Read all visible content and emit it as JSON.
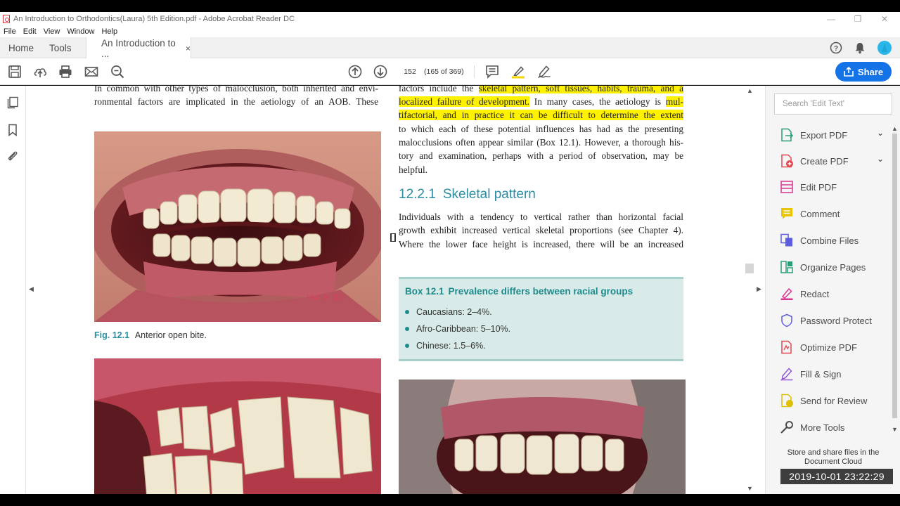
{
  "window": {
    "title": "An Introduction to Orthodontics(Laura) 5th Edition.pdf - Adobe Acrobat Reader DC"
  },
  "menu": [
    "File",
    "Edit",
    "View",
    "Window",
    "Help"
  ],
  "tabs": {
    "home": "Home",
    "tools": "Tools",
    "doc": "An Introduction to ...",
    "close": "×"
  },
  "toolbar": {
    "page_number": "152",
    "page_of": "(165 of 369)",
    "share_label": "Share"
  },
  "page": {
    "left_para_lines": [
      "In common with other types of malocclusion, both inherited and envi-",
      "ronmental factors are implicated in the aetiology of an AOB. These"
    ],
    "right_para1": {
      "l1_pre": "factors include the ",
      "l1_hl": "skeletal pattern, soft tissues, habits, trauma, and a",
      "l2_hl": "localized failure of development.",
      "l2_post": " In many cases, the aetiology is ",
      "l2_hl2": "mul-",
      "l3_hl": "tifactorial, and in practice it can be difficult to determine the extent",
      "l4": "to which each of these potential influences has had as the presenting",
      "l5": "malocclusions often appear similar (Box 12.1). However, a thorough his-",
      "l6": "tory and examination, perhaps with a period of observation, may be",
      "l7": "helpful."
    },
    "section": {
      "number": "12.2.1",
      "title": "Skeletal pattern"
    },
    "right_para2_lines": [
      "Individuals with a tendency to vertical rather than horizontal facial",
      "growth exhibit increased vertical skeletal proportions (see Chapter 4).",
      "Where the lower face height is increased, there will be an increased"
    ],
    "figure": {
      "label": "Fig. 12.1",
      "caption": "Anterior open bite."
    },
    "box": {
      "number": "Box 12.1",
      "title": "Prevalence differs between racial groups",
      "items": [
        "Caucasians: 2–4%.",
        "Afro-Caribbean: 5–10%.",
        "Chinese: 1.5–6%."
      ]
    }
  },
  "right_pane": {
    "search_placeholder": "Search 'Edit Text'",
    "tools": [
      {
        "label": "Export PDF",
        "icon": "export-pdf-icon",
        "color": "#2d9d78"
      },
      {
        "label": "Create PDF",
        "icon": "create-pdf-icon",
        "color": "#e34850"
      },
      {
        "label": "Edit PDF",
        "icon": "edit-pdf-icon",
        "color": "#d83790"
      },
      {
        "label": "Comment",
        "icon": "comment-icon",
        "color": "#dfbf00"
      },
      {
        "label": "Combine Files",
        "icon": "combine-files-icon",
        "color": "#5c5ce0"
      },
      {
        "label": "Organize Pages",
        "icon": "organize-pages-icon",
        "color": "#2d9d78"
      },
      {
        "label": "Redact",
        "icon": "redact-icon",
        "color": "#d83790"
      },
      {
        "label": "Password Protect",
        "icon": "password-protect-icon",
        "color": "#5c5ce0"
      },
      {
        "label": "Optimize PDF",
        "icon": "optimize-pdf-icon",
        "color": "#e34850"
      },
      {
        "label": "Fill & Sign",
        "icon": "fill-sign-icon",
        "color": "#9256d9"
      },
      {
        "label": "Send for Review",
        "icon": "send-review-icon",
        "color": "#dfbf00"
      },
      {
        "label": "More Tools",
        "icon": "more-tools-icon",
        "color": "#4b4b4b"
      }
    ],
    "cloud_text_1": "Store and share files in the",
    "cloud_text_2": "Document Cloud"
  },
  "overlay": {
    "timestamp": "2019-10-01 23:22:29"
  },
  "colors": {
    "accent": "#1473e6",
    "highlight": "#fff200",
    "heading_teal": "#2b8ea3"
  }
}
